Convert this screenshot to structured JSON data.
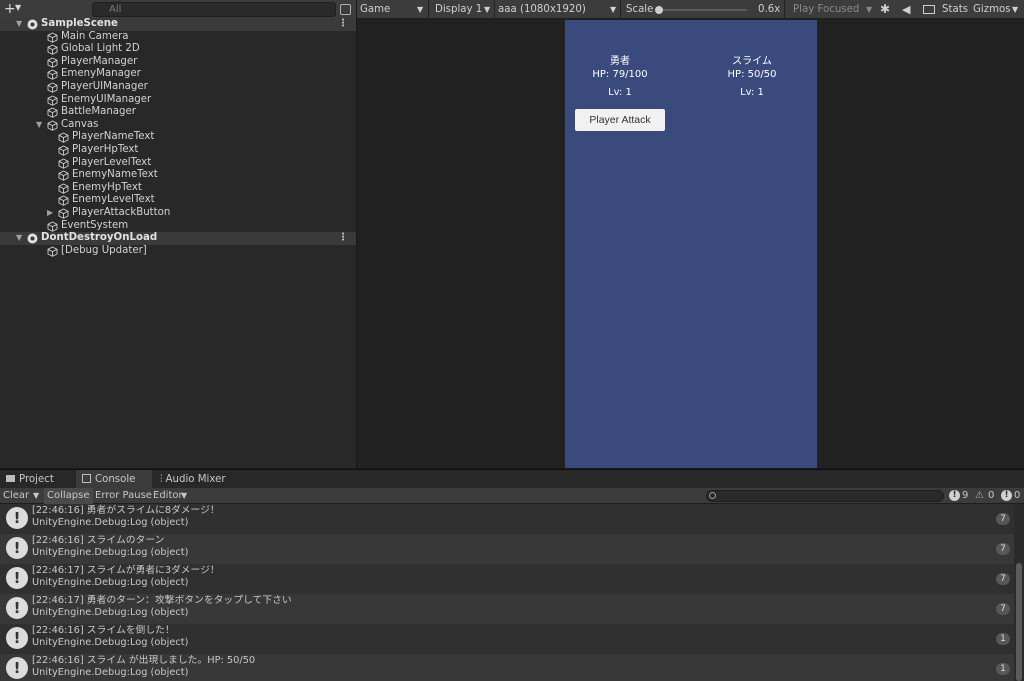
{
  "hierarchy": {
    "search_placeholder": "All",
    "items": [
      {
        "label": "SampleScene",
        "depth": 0,
        "scene": true,
        "expanded": true
      },
      {
        "label": "Main Camera",
        "depth": 1
      },
      {
        "label": "Global Light 2D",
        "depth": 1
      },
      {
        "label": "PlayerManager",
        "depth": 1
      },
      {
        "label": "EmenyManager",
        "depth": 1
      },
      {
        "label": "PlayerUIManager",
        "depth": 1
      },
      {
        "label": "EnemyUIManager",
        "depth": 1
      },
      {
        "label": "BattleManager",
        "depth": 1
      },
      {
        "label": "Canvas",
        "depth": 1,
        "expanded": true
      },
      {
        "label": "PlayerNameText",
        "depth": 2
      },
      {
        "label": "PlayerHpText",
        "depth": 2
      },
      {
        "label": "PlayerLevelText",
        "depth": 2
      },
      {
        "label": "EnemyNameText",
        "depth": 2
      },
      {
        "label": "EnemyHpText",
        "depth": 2
      },
      {
        "label": "EnemyLevelText",
        "depth": 2
      },
      {
        "label": "PlayerAttackButton",
        "depth": 2,
        "collapsed": true
      },
      {
        "label": "EventSystem",
        "depth": 1
      },
      {
        "label": "DontDestroyOnLoad",
        "depth": 0,
        "scene": true,
        "expanded": true
      },
      {
        "label": "[Debug Updater]",
        "depth": 1
      }
    ]
  },
  "game_toolbar": {
    "view": "Game",
    "display": "Display 1",
    "resolution": "aaa (1080x1920)",
    "scale_label": "Scale",
    "scale_value": "0.6x",
    "play_mode": "Play Focused",
    "stats": "Stats",
    "gizmos": "Gizmos"
  },
  "game": {
    "player_name": "勇者",
    "player_hp": "HP: 79/100",
    "player_lv": "Lv: 1",
    "enemy_name": "スライム",
    "enemy_hp": "HP: 50/50",
    "enemy_lv": "Lv: 1",
    "attack_button": "Player Attack"
  },
  "tabs": {
    "project": "Project",
    "console": "Console",
    "audio_mixer": "Audio Mixer"
  },
  "console_toolbar": {
    "clear": "Clear",
    "collapse": "Collapse",
    "error_pause": "Error Pause",
    "editor": "Editor",
    "log_count": "9",
    "warn_count": "0",
    "error_count": "0"
  },
  "logs": [
    {
      "line1": "[22:46:16] 勇者がスライムに8ダメージ！",
      "line2": "UnityEngine.Debug:Log (object)",
      "count": "7"
    },
    {
      "line1": "[22:46:16] スライムのターン",
      "line2": "UnityEngine.Debug:Log (object)",
      "count": "7"
    },
    {
      "line1": "[22:46:17] スライムが勇者に3ダメージ！",
      "line2": "UnityEngine.Debug:Log (object)",
      "count": "7"
    },
    {
      "line1": "[22:46:17] 勇者のターン：攻撃ボタンをタップして下さい",
      "line2": "UnityEngine.Debug:Log (object)",
      "count": "7"
    },
    {
      "line1": "[22:46:16] スライムを倒した！",
      "line2": "UnityEngine.Debug:Log (object)",
      "count": "1"
    },
    {
      "line1": "[22:46:16] スライム が出現しました。HP: 50/50",
      "line2": "UnityEngine.Debug:Log (object)",
      "count": "1"
    }
  ],
  "colors": {
    "game_background": "#3a4a7c",
    "panel": "#282828",
    "toolbar": "#3c3c3c"
  }
}
